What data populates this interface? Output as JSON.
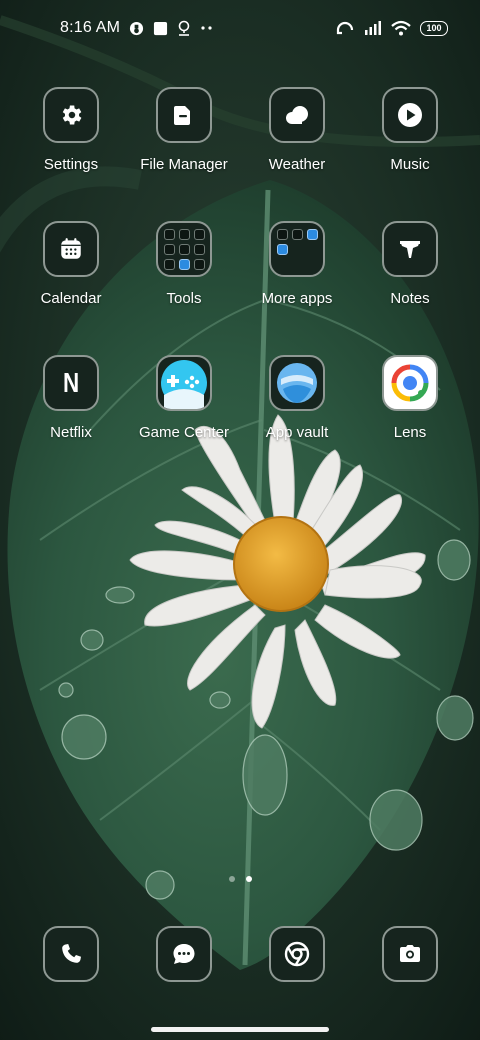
{
  "status_bar": {
    "time": "8:16 AM",
    "left_icons": [
      "vpn-icon",
      "square-notification-icon",
      "location-pin-icon",
      "more-dots-icon"
    ],
    "right_icons": [
      "hotspot-icon",
      "signal-bars-icon",
      "wifi-icon"
    ],
    "battery_level": "100"
  },
  "home": {
    "rows": [
      [
        {
          "label": "Settings",
          "icon": "gear-icon"
        },
        {
          "label": "File Manager",
          "icon": "folder-icon"
        },
        {
          "label": "Weather",
          "icon": "cloud-icon"
        },
        {
          "label": "Music",
          "icon": "play-icon"
        }
      ],
      [
        {
          "label": "Calendar",
          "icon": "calendar-icon"
        },
        {
          "label": "Tools",
          "icon": "tools-folder-icon"
        },
        {
          "label": "More apps",
          "icon": "more-apps-folder-icon"
        },
        {
          "label": "Notes",
          "icon": "notes-icon"
        }
      ],
      [
        {
          "label": "Netflix",
          "icon": "netflix-icon",
          "glyph": "N"
        },
        {
          "label": "Game Center",
          "icon": "game-controller-icon"
        },
        {
          "label": "App vault",
          "icon": "app-vault-icon"
        },
        {
          "label": "Lens",
          "icon": "lens-icon"
        }
      ]
    ]
  },
  "pager": {
    "pages": 2,
    "current": 2
  },
  "dock": [
    {
      "name": "phone",
      "icon": "phone-icon"
    },
    {
      "name": "messages",
      "icon": "chat-bubble-icon"
    },
    {
      "name": "chrome",
      "icon": "chrome-icon"
    },
    {
      "name": "camera",
      "icon": "camera-icon"
    }
  ],
  "colors": {
    "tile_background": "#16241e",
    "tile_border": "#8e9893",
    "lens_blue": "#4285f4",
    "lens_red": "#ea4335",
    "lens_yellow": "#fbbc05",
    "lens_green": "#34a853",
    "game_center_cyan": "#33c6f0",
    "daisy_center": "#e9a62e"
  }
}
